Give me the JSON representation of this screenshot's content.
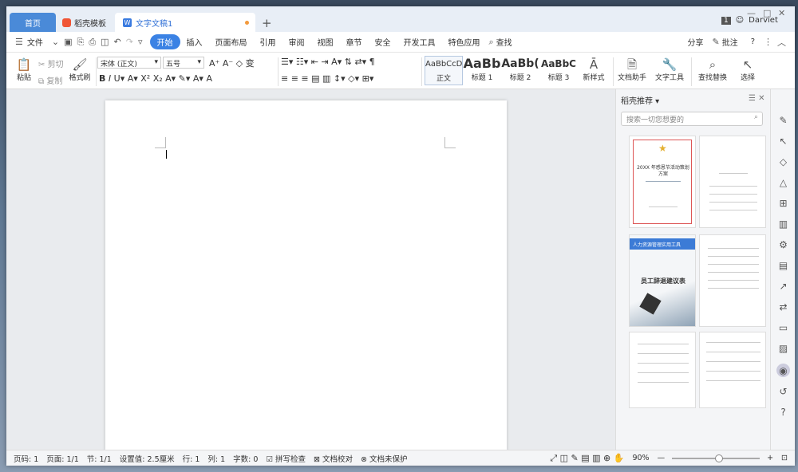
{
  "tabs": {
    "home": "首页",
    "templates": "稻壳模板",
    "doc": "文字文稿1"
  },
  "window": {
    "badge": "1",
    "user": "Darviet"
  },
  "menu": {
    "file": "文件",
    "items": [
      "开始",
      "插入",
      "页面布局",
      "引用",
      "审阅",
      "视图",
      "章节",
      "安全",
      "开发工具",
      "特色应用"
    ],
    "search": "查找",
    "share": "分享",
    "comment": "批注",
    "help": "?"
  },
  "ribbon": {
    "paste": "粘贴",
    "cut": "剪切",
    "copy": "复制",
    "format_painter": "格式刷",
    "font": "宋体 (正文)",
    "size": "五号",
    "styles": [
      {
        "preview": "AaBbCcDd",
        "name": "正文"
      },
      {
        "preview": "AaBb",
        "name": "标题 1"
      },
      {
        "preview": "AaBb(",
        "name": "标题 2"
      },
      {
        "preview": "AaBbC",
        "name": "标题 3"
      }
    ],
    "new_style": "新样式",
    "assistant": "文档助手",
    "text_tools": "文字工具",
    "find_replace": "查找替换",
    "select": "选择"
  },
  "panel": {
    "title": "稻壳推荐",
    "search_placeholder": "搜索一切您想要的",
    "t1_title": "20XX 年感恩节活动策划方案",
    "t3_header": "人力资源管理实用工具",
    "t3_title": "员工辞退建议表"
  },
  "status": {
    "page": "页码: 1",
    "pages": "页面: 1/1",
    "section": "节: 1/1",
    "setting": "设置值: 2.5厘米",
    "row": "行: 1",
    "col": "列: 1",
    "words": "字数: 0",
    "spell": "拼写检查",
    "proof": "文档校对",
    "protect": "文档未保护",
    "zoom": "90%"
  },
  "colors": {
    "accent": "#3b82e4",
    "tab_home": "#4a8ad8"
  }
}
